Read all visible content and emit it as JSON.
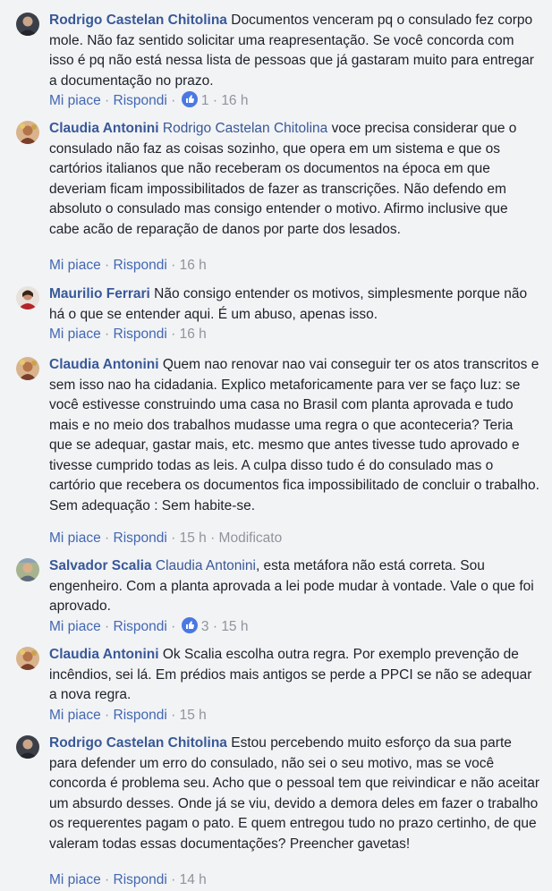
{
  "labels": {
    "like": "Mi piace",
    "reply": "Rispondi",
    "sep": " · "
  },
  "comments": [
    {
      "author": "Rodrigo Castelan Chitolina",
      "mention": "",
      "text": "Documentos venceram pq o consulado fez corpo mole. Não faz sentido solicitar uma reapresentação. Se você concorda com isso é pq não está nessa lista de pessoas que já gastaram muito para entregar a documentação no prazo.",
      "reactions": "1",
      "time": "16 h",
      "edited": ""
    },
    {
      "author": "Claudia Antonini",
      "mention": "Rodrigo Castelan Chitolina",
      "text": "voce precisa considerar que o consulado não faz as coisas sozinho, que opera em um sistema e que os cartórios italianos que não receberam os documentos na época em que deveriam ficam impossibilitados de fazer as transcrições. Não defendo em absoluto o consulado mas consigo entender o motivo. Afirmo inclusive que cabe acão de reparação de danos por parte dos lesados.",
      "reactions": "",
      "time": "16 h",
      "edited": ""
    },
    {
      "author": "Maurilio Ferrari",
      "mention": "",
      "text": "Não consigo entender os motivos, simplesmente porque não há o que se entender aqui. É um abuso, apenas isso.",
      "reactions": "",
      "time": "16 h",
      "edited": ""
    },
    {
      "author": "Claudia Antonini",
      "mention": "",
      "text": "Quem nao renovar nao vai conseguir ter os atos transcritos e sem isso nao ha cidadania. Explico metaforicamente para ver se faço luz: se você estivesse construindo uma casa no Brasil com planta aprovada e tudo mais e no meio dos trabalhos mudasse uma regra o que aconteceria? Teria que se adequar, gastar mais, etc. mesmo que antes tivesse tudo aprovado e tivesse cumprido todas as leis. A culpa disso tudo é do consulado mas o cartório que recebera os documentos fica impossibilitado de concluir o trabalho. Sem adequação : Sem habite-se.",
      "reactions": "",
      "time": "15 h",
      "edited": "Modificato"
    },
    {
      "author": "Salvador Scalia",
      "mention": "Claudia Antonini",
      "text": ", esta metáfora não está correta. Sou engenheiro. Com a planta aprovada a lei pode mudar à vontade. Vale o que foi aprovado.",
      "reactions": "3",
      "time": "15 h",
      "edited": ""
    },
    {
      "author": "Claudia Antonini",
      "mention": "",
      "text": "Ok Scalia escolha outra regra. Por exemplo prevenção de incêndios, sei lá. Em prédios mais antigos se perde a PPCI se não se adequar a nova regra.",
      "reactions": "",
      "time": "15 h",
      "edited": ""
    },
    {
      "author": "Rodrigo Castelan Chitolina",
      "mention": "",
      "text": "Estou percebendo muito esforço da sua parte para defender um erro do consulado, não sei o seu motivo, mas se você concorda é problema seu. Acho que o pessoal tem que reivindicar e não aceitar um absurdo desses. Onde já se viu, devido a demora deles em fazer o trabalho os requerentes pagam o pato. E quem entregou tudo no prazo certinho, de que valeram todas essas documentações? Preencher gavetas!",
      "reactions": "",
      "time": "14 h",
      "edited": ""
    }
  ]
}
